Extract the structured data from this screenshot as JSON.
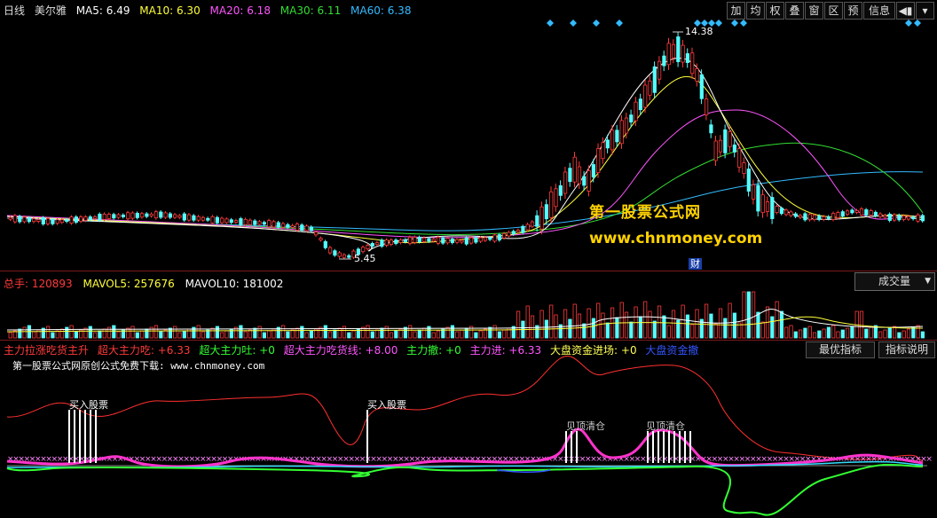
{
  "header": {
    "period": "日线",
    "stock": "美尔雅",
    "ma5": "MA5: 6.49",
    "ma10": "MA10: 6.30",
    "ma20": "MA20: 6.18",
    "ma30": "MA30: 6.11",
    "ma60": "MA60: 6.38"
  },
  "toolbar": {
    "buttons": [
      "加",
      "均",
      "权",
      "叠",
      "窗",
      "区",
      "预",
      "信息"
    ],
    "more_label": "▾"
  },
  "main": {
    "high_label": "14.38",
    "low_label": "5.45",
    "watermark_cn": "第一股票公式网",
    "watermark_url": "www.chnmoney.com",
    "finance_badge": "财"
  },
  "volume": {
    "total": "总手: 120893",
    "mavol5": "MAVOL5: 257676",
    "mavol10": "MAVOL10: 181002",
    "dropdown": "成交量"
  },
  "indicator": {
    "items": [
      {
        "text": "主力拉涨吃货主升",
        "color": "#ff3a3a"
      },
      {
        "text": "超大主力吃: +6.33",
        "color": "#ff3a3a"
      },
      {
        "text": "超大主力吐: +0",
        "color": "#33ff33"
      },
      {
        "text": "超大主力吃货线: +8.00",
        "color": "#ff55ff"
      },
      {
        "text": "主力撤: +0",
        "color": "#33ff33"
      },
      {
        "text": "主力进: +6.33",
        "color": "#ff55ff"
      },
      {
        "text": "大盘资金进场: +0",
        "color": "#ffff55"
      },
      {
        "text": "大盘资金撤",
        "color": "#3355ff"
      }
    ],
    "btn_best": "最优指标",
    "btn_help": "指标说明",
    "subtitle": "第一股票公式网原创公式免费下载: www.chnmoney.com",
    "buy1": "买入股票",
    "buy2": "买入股票",
    "top1": "见顶清仓",
    "top2": "见顶清仓"
  },
  "colors": {
    "up": "#ff3a3a",
    "down": "#54ffff",
    "ma5": "#ffffff",
    "ma10": "#ffff3a",
    "ma20": "#ff55ff",
    "ma30": "#33dd33",
    "ma60": "#33bbff"
  },
  "icons": {
    "prev": "prev-icon",
    "dropdown": "dropdown-icon",
    "diamond": "signal-diamond-icon"
  }
}
